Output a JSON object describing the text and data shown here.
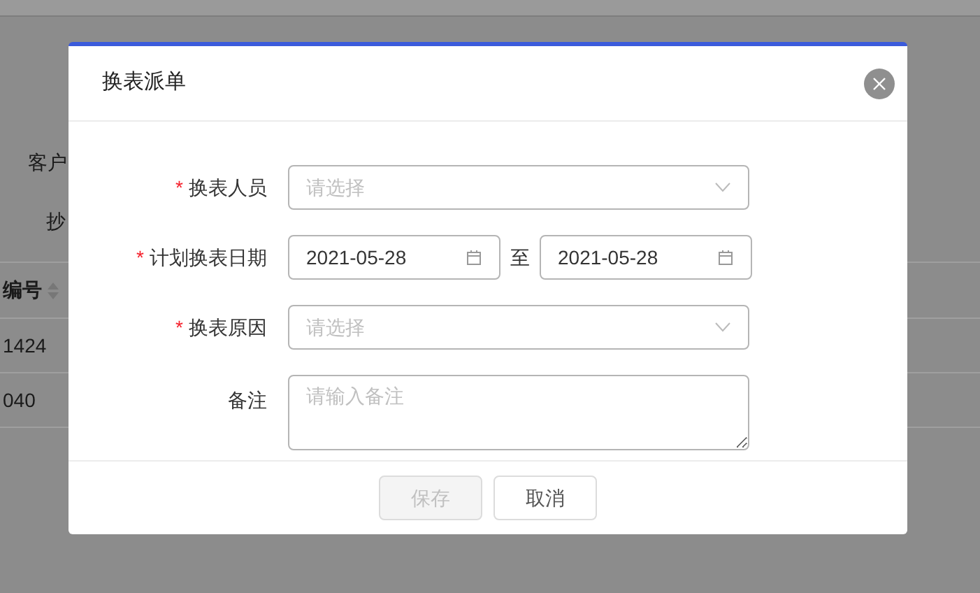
{
  "background": {
    "form_labels": [
      "客户",
      "抄"
    ],
    "table": {
      "column_header": "编号",
      "rows": [
        "1424",
        "040"
      ]
    }
  },
  "dialog": {
    "title": "换表派单",
    "fields": [
      {
        "kind": "select",
        "label": "换表人员",
        "required_mark": "*",
        "placeholder": "请选择"
      },
      {
        "kind": "daterange",
        "label": "计划换表日期",
        "required_mark": "*",
        "start": "2021-05-28",
        "separator": "至",
        "end": "2021-05-28"
      },
      {
        "kind": "select",
        "label": "换表原因",
        "required_mark": "*",
        "placeholder": "请选择"
      },
      {
        "kind": "textarea",
        "label": "备注",
        "placeholder": "请输入备注"
      }
    ],
    "buttons": [
      {
        "label": "保存",
        "disabled": true
      },
      {
        "label": "取消",
        "disabled": false
      }
    ]
  }
}
